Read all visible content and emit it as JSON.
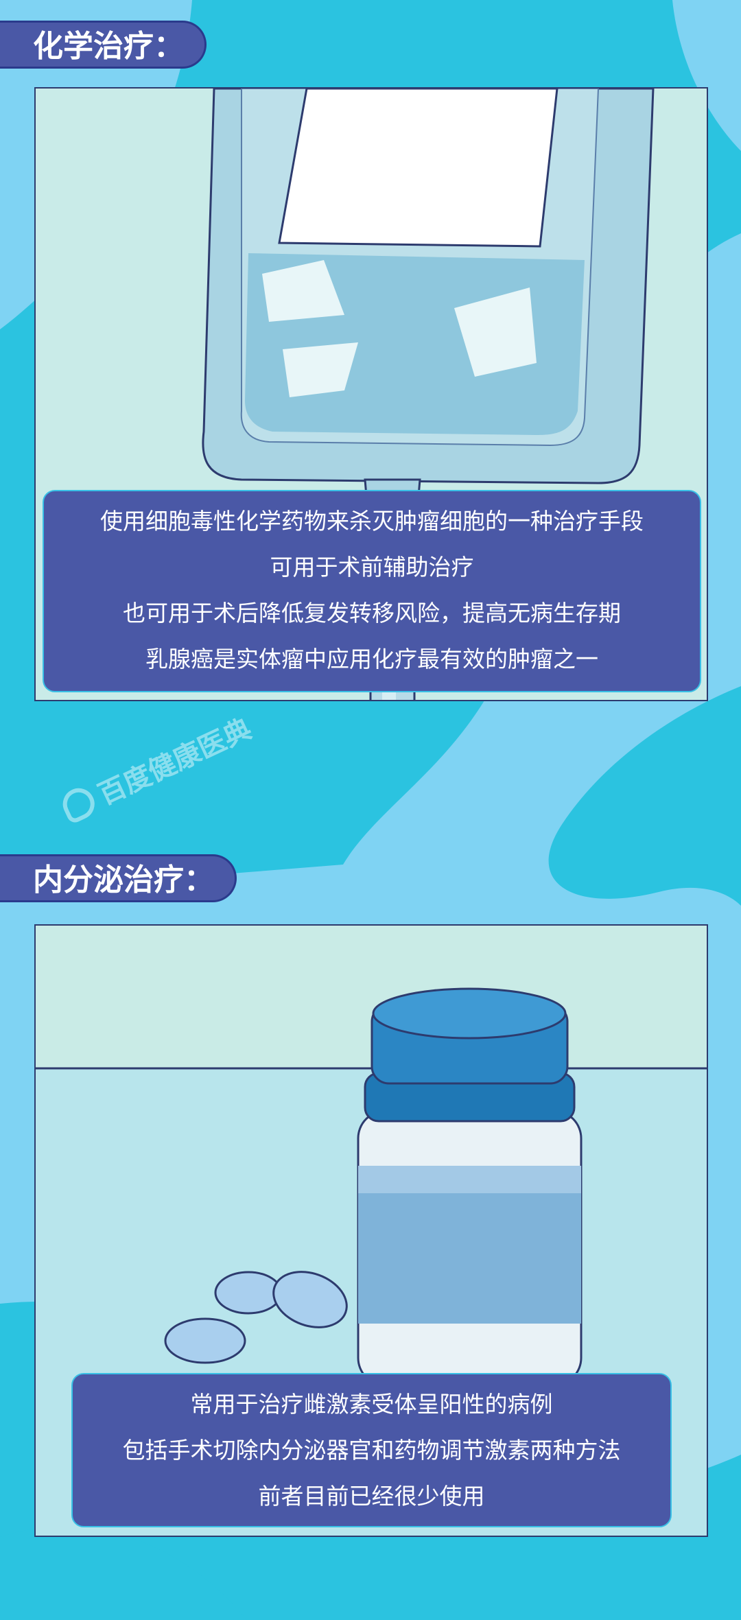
{
  "sections": [
    {
      "title": "化学治疗：",
      "lines": [
        "使用细胞毒性化学药物来杀灭肿瘤细胞的一种治疗手段",
        "可用于术前辅助治疗",
        "也可用于术后降低复发转移风险，提高无病生存期",
        "乳腺癌是实体瘤中应用化疗最有效的肿瘤之一"
      ]
    },
    {
      "title": "内分泌治疗：",
      "lines": [
        "常用于治疗雌激素受体呈阳性的病例",
        "包括手术切除内分泌器官和药物调节激素两种方法",
        "前者目前已经很少使用"
      ]
    }
  ],
  "watermark": "百度健康医典",
  "colors": {
    "background": "#2bc3e0",
    "blob": "#7fd3f3",
    "tag": "#4a58a6",
    "caption": "#4a58a6"
  }
}
